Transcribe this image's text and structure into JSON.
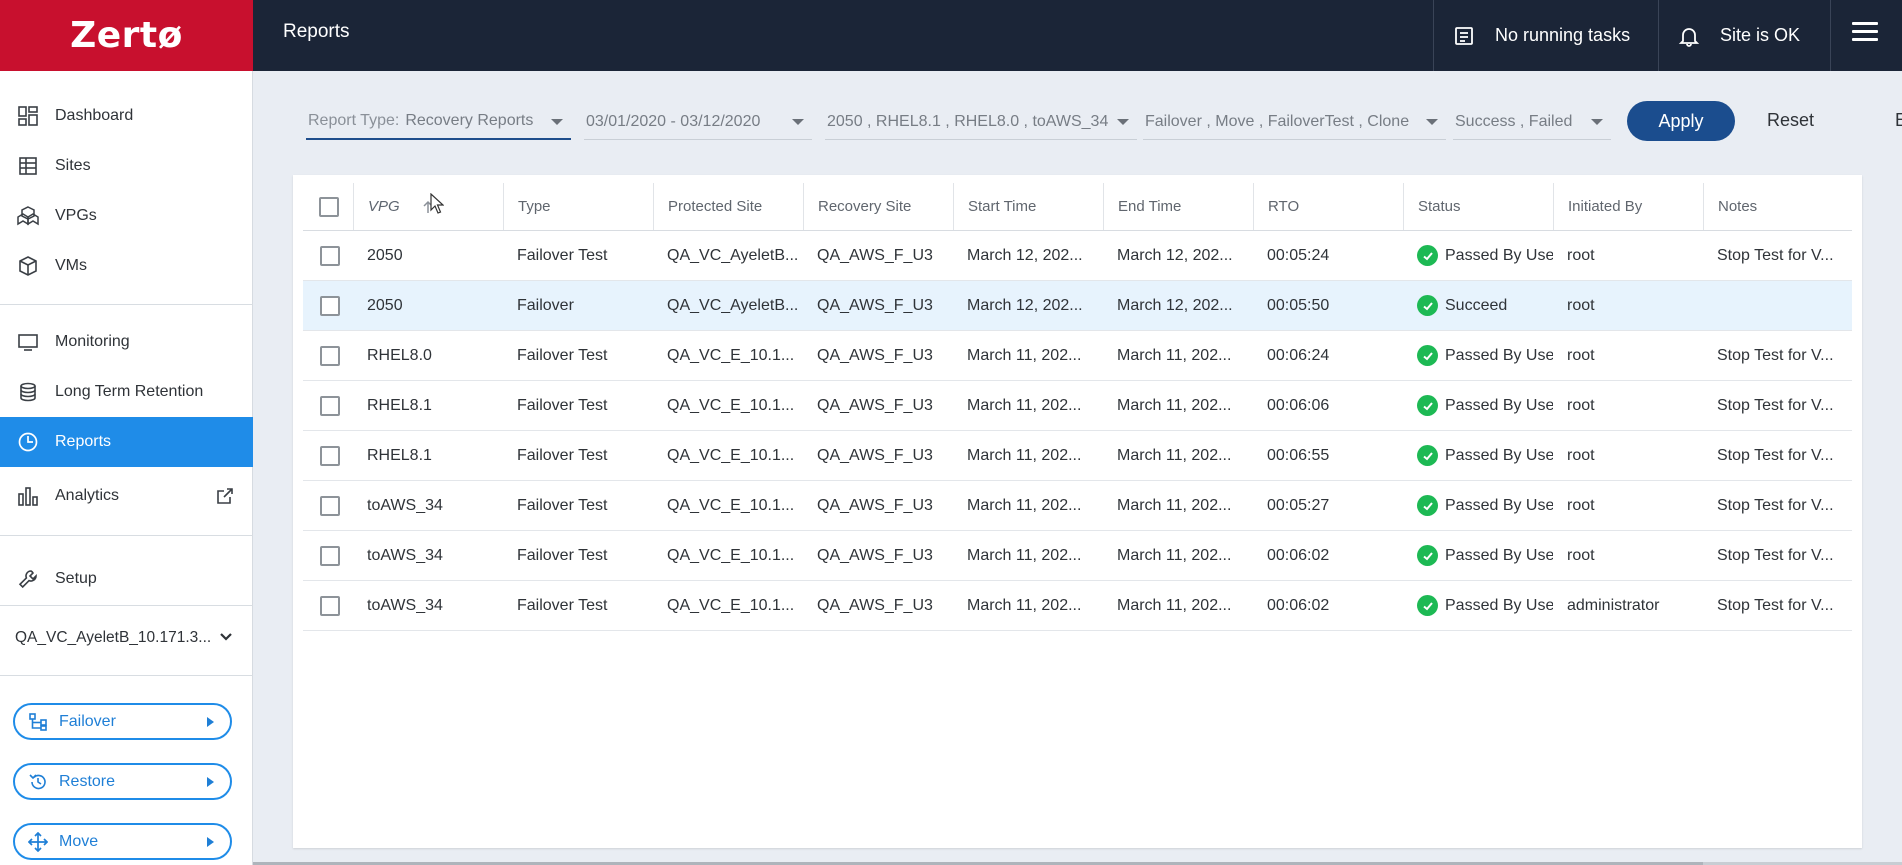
{
  "brand": {
    "logo_text": "Zertø",
    "color": "#c8102e"
  },
  "sidebar": {
    "nav_items": [
      {
        "label": "Dashboard",
        "icon": "dashboard-icon"
      },
      {
        "label": "Sites",
        "icon": "sites-icon"
      },
      {
        "label": "VPGs",
        "icon": "vpgs-icon"
      },
      {
        "label": "VMs",
        "icon": "vms-icon"
      },
      {
        "label": "Monitoring",
        "icon": "monitor-icon"
      },
      {
        "label": "Long Term Retention",
        "icon": "database-icon"
      },
      {
        "label": "Reports",
        "icon": "reports-icon",
        "active": true
      },
      {
        "label": "Analytics",
        "icon": "bar-chart-icon",
        "external": true
      },
      {
        "label": "Setup",
        "icon": "wrench-icon"
      }
    ],
    "site_selector": "QA_VC_AyeletB_10.171.3...",
    "actions": [
      {
        "label": "Failover",
        "icon": "failover-icon"
      },
      {
        "label": "Restore",
        "icon": "restore-icon"
      },
      {
        "label": "Move",
        "icon": "move-icon"
      }
    ]
  },
  "topbar": {
    "title": "Reports",
    "tasks_label": "No running tasks",
    "site_status": "Site is OK"
  },
  "filters": {
    "report_type_label": "Report Type:",
    "report_type_value": "Recovery Reports",
    "date_range": "03/01/2020 - 03/12/2020",
    "vpgs": "2050 , RHEL8.1 , RHEL8.0 , toAWS_34",
    "operation_types": "Failover , Move , FailoverTest , Clone",
    "statuses": "Success , Failed",
    "apply_label": "Apply",
    "reset_label": "Reset",
    "export_label": "E"
  },
  "table": {
    "columns": [
      "VPG",
      "Type",
      "Protected Site",
      "Recovery Site",
      "Start Time",
      "End Time",
      "RTO",
      "Status",
      "Initiated By",
      "Notes"
    ],
    "rows": [
      {
        "vpg": "2050",
        "type": "Failover Test",
        "protected": "QA_VC_AyeletB...",
        "recovery": "QA_AWS_F_U3",
        "start": "March 12, 202...",
        "end": "March 12, 202...",
        "rto": "00:05:24",
        "status": "Passed By Use",
        "by": "root",
        "notes": "Stop Test for V..."
      },
      {
        "vpg": "2050",
        "type": "Failover",
        "protected": "QA_VC_AyeletB...",
        "recovery": "QA_AWS_F_U3",
        "start": "March 12, 202...",
        "end": "March 12, 202...",
        "rto": "00:05:50",
        "status": "Succeed",
        "by": "root",
        "notes": ""
      },
      {
        "vpg": "RHEL8.0",
        "type": "Failover Test",
        "protected": "QA_VC_E_10.1...",
        "recovery": "QA_AWS_F_U3",
        "start": "March 11, 202...",
        "end": "March 11, 202...",
        "rto": "00:06:24",
        "status": "Passed By Use",
        "by": "root",
        "notes": "Stop Test for V..."
      },
      {
        "vpg": "RHEL8.1",
        "type": "Failover Test",
        "protected": "QA_VC_E_10.1...",
        "recovery": "QA_AWS_F_U3",
        "start": "March 11, 202...",
        "end": "March 11, 202...",
        "rto": "00:06:06",
        "status": "Passed By Use",
        "by": "root",
        "notes": "Stop Test for V..."
      },
      {
        "vpg": "RHEL8.1",
        "type": "Failover Test",
        "protected": "QA_VC_E_10.1...",
        "recovery": "QA_AWS_F_U3",
        "start": "March 11, 202...",
        "end": "March 11, 202...",
        "rto": "00:06:55",
        "status": "Passed By Use",
        "by": "root",
        "notes": "Stop Test for V..."
      },
      {
        "vpg": "toAWS_34",
        "type": "Failover Test",
        "protected": "QA_VC_E_10.1...",
        "recovery": "QA_AWS_F_U3",
        "start": "March 11, 202...",
        "end": "March 11, 202...",
        "rto": "00:05:27",
        "status": "Passed By Use",
        "by": "root",
        "notes": "Stop Test for V..."
      },
      {
        "vpg": "toAWS_34",
        "type": "Failover Test",
        "protected": "QA_VC_E_10.1...",
        "recovery": "QA_AWS_F_U3",
        "start": "March 11, 202...",
        "end": "March 11, 202...",
        "rto": "00:06:02",
        "status": "Passed By Use",
        "by": "root",
        "notes": "Stop Test for V..."
      },
      {
        "vpg": "toAWS_34",
        "type": "Failover Test",
        "protected": "QA_VC_E_10.1...",
        "recovery": "QA_AWS_F_U3",
        "start": "March 11, 202...",
        "end": "March 11, 202...",
        "rto": "00:06:02",
        "status": "Passed By Use",
        "by": "administrator",
        "notes": "Stop Test for V..."
      }
    ],
    "selected_row": 1
  }
}
